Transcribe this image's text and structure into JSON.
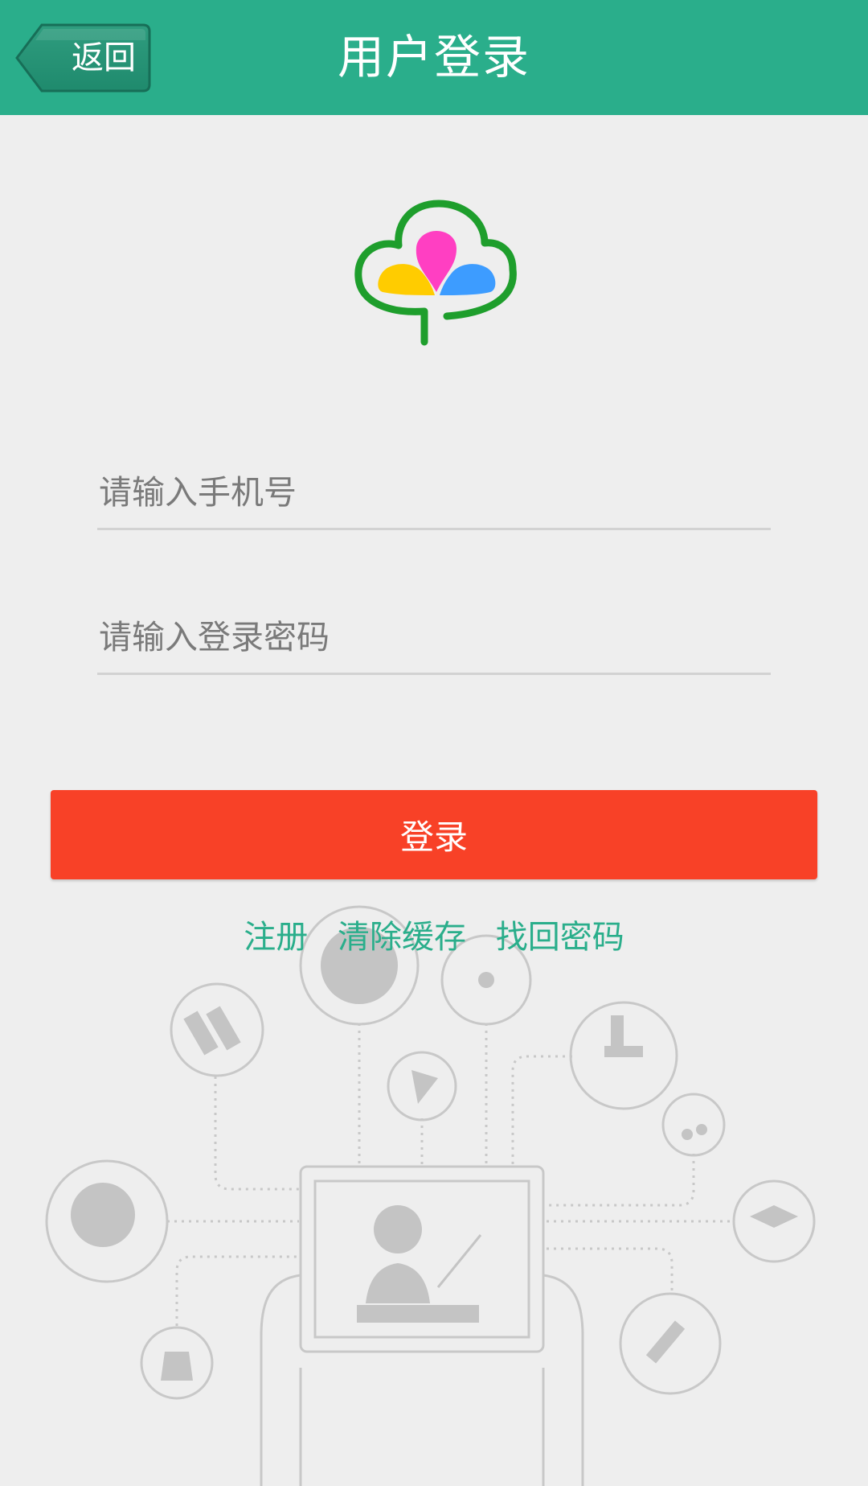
{
  "header": {
    "back_label": "返回",
    "title": "用户登录",
    "background_color": "#2aae8b"
  },
  "logo": {
    "icon": "cloud-petal-logo",
    "colors": [
      "#1e9e2c",
      "#ff3fc2",
      "#ffcc00",
      "#3d9cff"
    ]
  },
  "form": {
    "phone_placeholder": "请输入手机号",
    "phone_value": "",
    "password_placeholder": "请输入登录密码",
    "password_value": ""
  },
  "login_button": {
    "label": "登录",
    "color": "#f84127"
  },
  "links": {
    "register": "注册",
    "clear_cache": "清除缓存",
    "find_password": "找回密码",
    "color": "#2aae8b"
  },
  "illustration": {
    "icons": [
      "basketball-icon",
      "atom-icon",
      "books-icon",
      "microscope-icon",
      "compass-icon",
      "music-note-icon",
      "globe-icon",
      "graduation-cap-icon",
      "flask-icon",
      "test-tube-icon",
      "teacher-tablet-icon"
    ]
  }
}
